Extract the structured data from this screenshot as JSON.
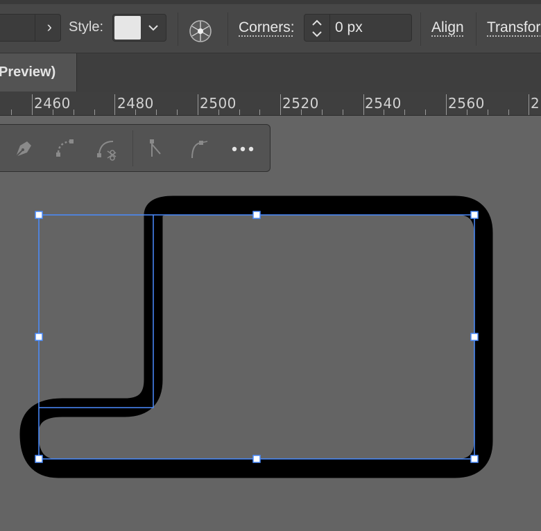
{
  "control_bar": {
    "style_label": "Style:",
    "corners_label": "Corners:",
    "corners_value": "0 px",
    "align_label": "Align",
    "transform_label": "Transfor",
    "style_swatch_color": "#e6e6e6"
  },
  "tabs": [
    {
      "label": "Preview)"
    }
  ],
  "ruler": {
    "labels": [
      "2460",
      "2480",
      "2500",
      "2520",
      "2540",
      "2560",
      "2"
    ]
  },
  "floating_toolbar": {
    "tools": [
      "pen-tool-icon",
      "anchor-point-icon",
      "scissors-icon",
      "direct-select-icon",
      "curvature-icon",
      "more-icon"
    ]
  },
  "colors": {
    "selection": "#4a8cff",
    "shape_stroke": "#000000",
    "canvas": "#646464"
  }
}
